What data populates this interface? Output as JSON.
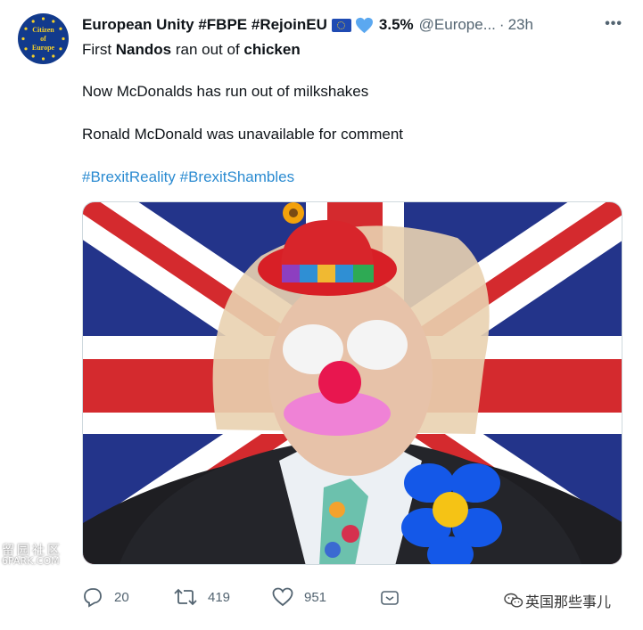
{
  "tweet": {
    "author_name": "European Unity #FBPE #RejoinEU",
    "author_badge_pct": "3.5%",
    "handle": "@Europe...",
    "separator": "·",
    "time": "23h",
    "avatar_text": "Citizen\nof\nEurope",
    "lines": {
      "l1_a": "First ",
      "l1_b": "Nandos",
      "l1_c": " ran out of ",
      "l1_d": "chicken",
      "l2": "Now McDonalds has run out of milkshakes",
      "l3": "Ronald McDonald was unavailable for comment"
    },
    "hashtags": [
      "#BrexitReality",
      "#BrexitShambles"
    ]
  },
  "actions": {
    "reply_count": "20",
    "retweet_count": "419",
    "like_count": "951"
  },
  "watermarks": {
    "left_line1": "留园社区",
    "left_line2": "6PARK.COM",
    "right": "英国那些事儿"
  },
  "icons": [
    "more-icon",
    "eu-flag-icon",
    "blue-heart-icon",
    "reply-icon",
    "retweet-icon",
    "like-icon",
    "share-icon",
    "wechat-icon"
  ],
  "colors": {
    "link": "#2b8bd1",
    "muted": "#536471",
    "text": "#0f1419"
  }
}
